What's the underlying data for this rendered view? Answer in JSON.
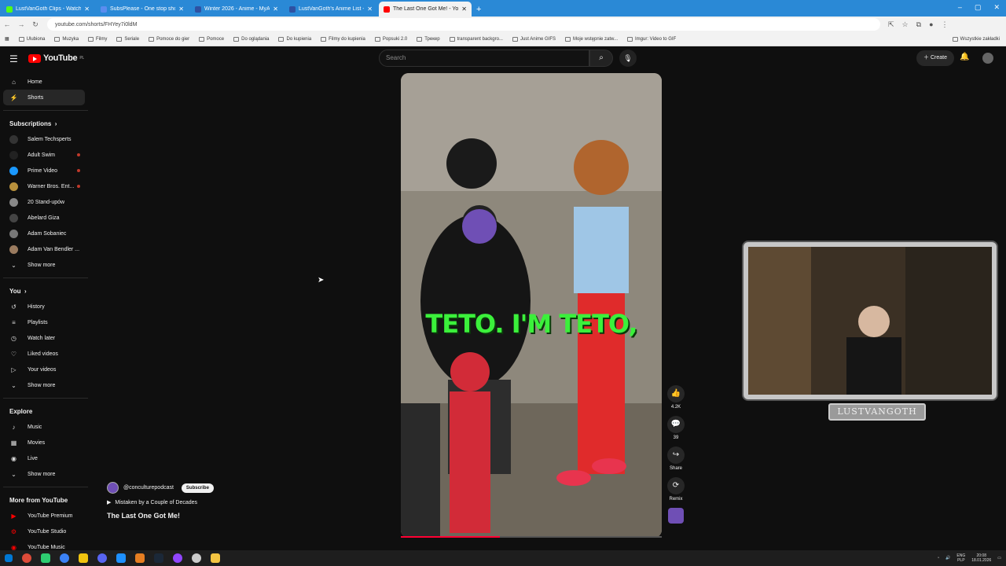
{
  "browser": {
    "tabs": [
      {
        "title": "LustVanGoth Clips - Watch Live",
        "color": "#53fc18",
        "active": false
      },
      {
        "title": "SubsPlease - One stop shop fo",
        "color": "#5b8def",
        "active": false
      },
      {
        "title": "Winter 2026 - Anime - MyAnim",
        "color": "#2e51a2",
        "active": false
      },
      {
        "title": "LustVanGoth's Anime List - My",
        "color": "#2e51a2",
        "active": false
      },
      {
        "title": "The Last One Got Me! - You",
        "color": "#ff0000",
        "active": true
      }
    ],
    "url": "youtube.com/shorts/FHYey7i0ldM",
    "bookmarks": [
      "Ulubiona",
      "Muzyka",
      "Filmy",
      "Seriale",
      "Pomoce do gier",
      "Pomoce",
      "Do oglądania",
      "Do kupienia",
      "Filmy do kupienia",
      "Popsuki 2.0",
      "Трекер",
      "transparent backgro...",
      "Just Anime GIFS",
      "Moje wstępnie zatw...",
      "Imgur: Video to GIF"
    ],
    "bookmarks_right": "Wszystkie zakładki"
  },
  "header": {
    "logo_text": "YouTube",
    "logo_region": "PL",
    "search_placeholder": "Search",
    "create_label": "Create"
  },
  "sidebar": {
    "home": "Home",
    "shorts": "Shorts",
    "subscriptions_title": "Subscriptions",
    "subscriptions": [
      {
        "name": "Salem Techsperts",
        "color": "#333333",
        "live": false
      },
      {
        "name": "Adult Swim",
        "color": "#222222",
        "live": true
      },
      {
        "name": "Prime Video",
        "color": "#1a98ff",
        "live": true
      },
      {
        "name": "Warner Bros. Ent...",
        "color": "#b8903c",
        "live": true
      },
      {
        "name": "20 Stand-upów",
        "color": "#888888",
        "live": false
      },
      {
        "name": "Abelard Giza",
        "color": "#444444",
        "live": false
      },
      {
        "name": "Adam Sobaniec",
        "color": "#777777",
        "live": false
      },
      {
        "name": "Adam Van Bendler ...",
        "color": "#9a7b5f",
        "live": false
      }
    ],
    "show_more": "Show more",
    "you_title": "You",
    "you_items": [
      "History",
      "Playlists",
      "Watch later",
      "Liked videos",
      "Your videos"
    ],
    "explore_title": "Explore",
    "explore_items": [
      "Music",
      "Movies",
      "Live"
    ],
    "more_title": "More from YouTube",
    "more_items": [
      "YouTube Premium",
      "YouTube Studio",
      "YouTube Music"
    ]
  },
  "short": {
    "caption": "TETO. I'M TETO,",
    "channel": "@conculturepodcast",
    "subscribe_label": "Subscribe",
    "track": "Mistaken by a Couple of Decades",
    "title": "The Last One Got Me!",
    "progress": 0.38,
    "likes": "4.2K",
    "comments": "39",
    "share_label": "Share",
    "remix_label": "Remix"
  },
  "webcam": {
    "badge": "LUSTVANGOTH"
  },
  "taskbar": {
    "lang": "ENG\nPLP",
    "time": "20:08",
    "date": "18.01.2026"
  }
}
